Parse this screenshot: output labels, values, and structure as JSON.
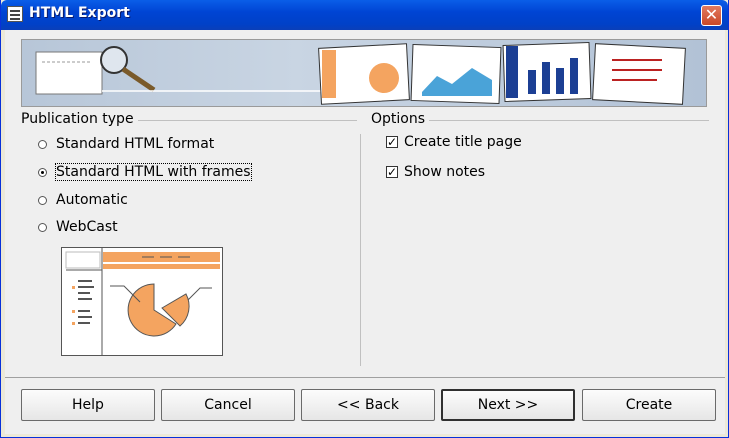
{
  "window": {
    "title": "HTML Export"
  },
  "publication": {
    "heading": "Publication type",
    "options": [
      {
        "label": "Standard HTML format",
        "checked": false
      },
      {
        "label": "Standard HTML with frames",
        "checked": true
      },
      {
        "label": "Automatic",
        "checked": false
      },
      {
        "label": "WebCast",
        "checked": false
      }
    ]
  },
  "options": {
    "heading": "Options",
    "items": [
      {
        "label": "Create title page",
        "checked": true
      },
      {
        "label": "Show notes",
        "checked": true
      }
    ]
  },
  "buttons": {
    "help": "Help",
    "cancel": "Cancel",
    "back": "<< Back",
    "next": "Next >>",
    "create": "Create"
  },
  "colors": {
    "accent": "#f4a460",
    "title_bar": "#0044d4"
  }
}
